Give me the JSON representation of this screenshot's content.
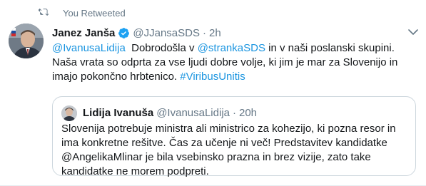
{
  "retweet": {
    "label": "You Retweeted",
    "icon": "retweet-icon"
  },
  "tweet": {
    "author_name": "Janez Janša",
    "handle": "@JJansaSDS",
    "separator": "·",
    "time": "2h",
    "text": {
      "mention1": "@IvanusaLidija",
      "part1": "  Dobrodošla v ",
      "mention2": "@strankaSDS",
      "part2": " in v naši poslanski skupini. Naša vrata so odprta za vse ljudi dobre volje, ki jim je mar za Slovenijo in imajo pokončno hrbtenico. ",
      "hashtag": "#ViribusUnitis"
    }
  },
  "quoted": {
    "author_name": "Lidija Ivanuša",
    "handle": "@IvanusaLidija",
    "separator": "·",
    "time": "20h",
    "text": "Slovenija potrebuje ministra ali ministrico za kohezijo, ki pozna resor in ima konkretne rešitve. Čas za učenje ni več! Predstavitev kandidatke @AngelikaMlinar je bila vsebinsko prazna in brez vizije, zato take kandidatke ne morem podpreti."
  },
  "colors": {
    "link": "#1b95e0",
    "secondary": "#657786",
    "verified": "#1da1f2",
    "border": "#ccd6dd"
  }
}
